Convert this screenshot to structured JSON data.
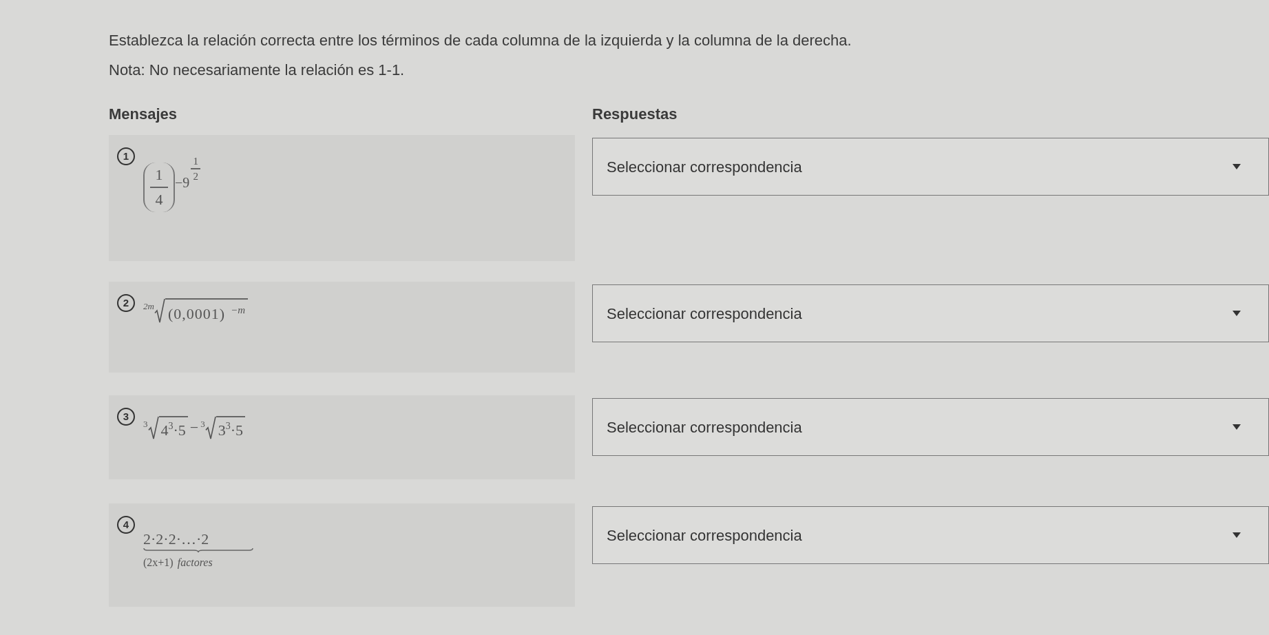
{
  "instructions": "Establezca la relación correcta entre los términos de cada columna de la izquierda y la columna de la derecha.",
  "note": "Nota: No necesariamente la relación es 1-1.",
  "columns": {
    "left": "Mensajes",
    "right": "Respuestas"
  },
  "items": [
    {
      "number": "1",
      "expression": {
        "kind": "power",
        "numerator": "1",
        "denominator": "4",
        "exponent": "−9",
        "exponent_power_numerator": "1",
        "exponent_power_denominator": "2"
      },
      "answer": {
        "placeholder": "Seleccionar correspondencia"
      }
    },
    {
      "number": "2",
      "expression": {
        "kind": "root",
        "index": "2m",
        "radicand": "(0,0001)",
        "radicand_exponent": "−m"
      },
      "answer": {
        "placeholder": "Seleccionar correspondencia"
      }
    },
    {
      "number": "3",
      "expression": {
        "kind": "root_difference",
        "operator": "−",
        "terms": [
          {
            "index": "3",
            "base": "4",
            "exponent": "3",
            "factor": "·5"
          },
          {
            "index": "3",
            "base": "3",
            "exponent": "3",
            "factor": "·5"
          }
        ]
      },
      "answer": {
        "placeholder": "Seleccionar correspondencia"
      }
    },
    {
      "number": "4",
      "expression": {
        "kind": "underbrace",
        "top": "2·2·2·…·2",
        "bottom": "(2x+1)",
        "bottom_word": "factores"
      },
      "answer": {
        "placeholder": "Seleccionar correspondencia"
      }
    }
  ]
}
